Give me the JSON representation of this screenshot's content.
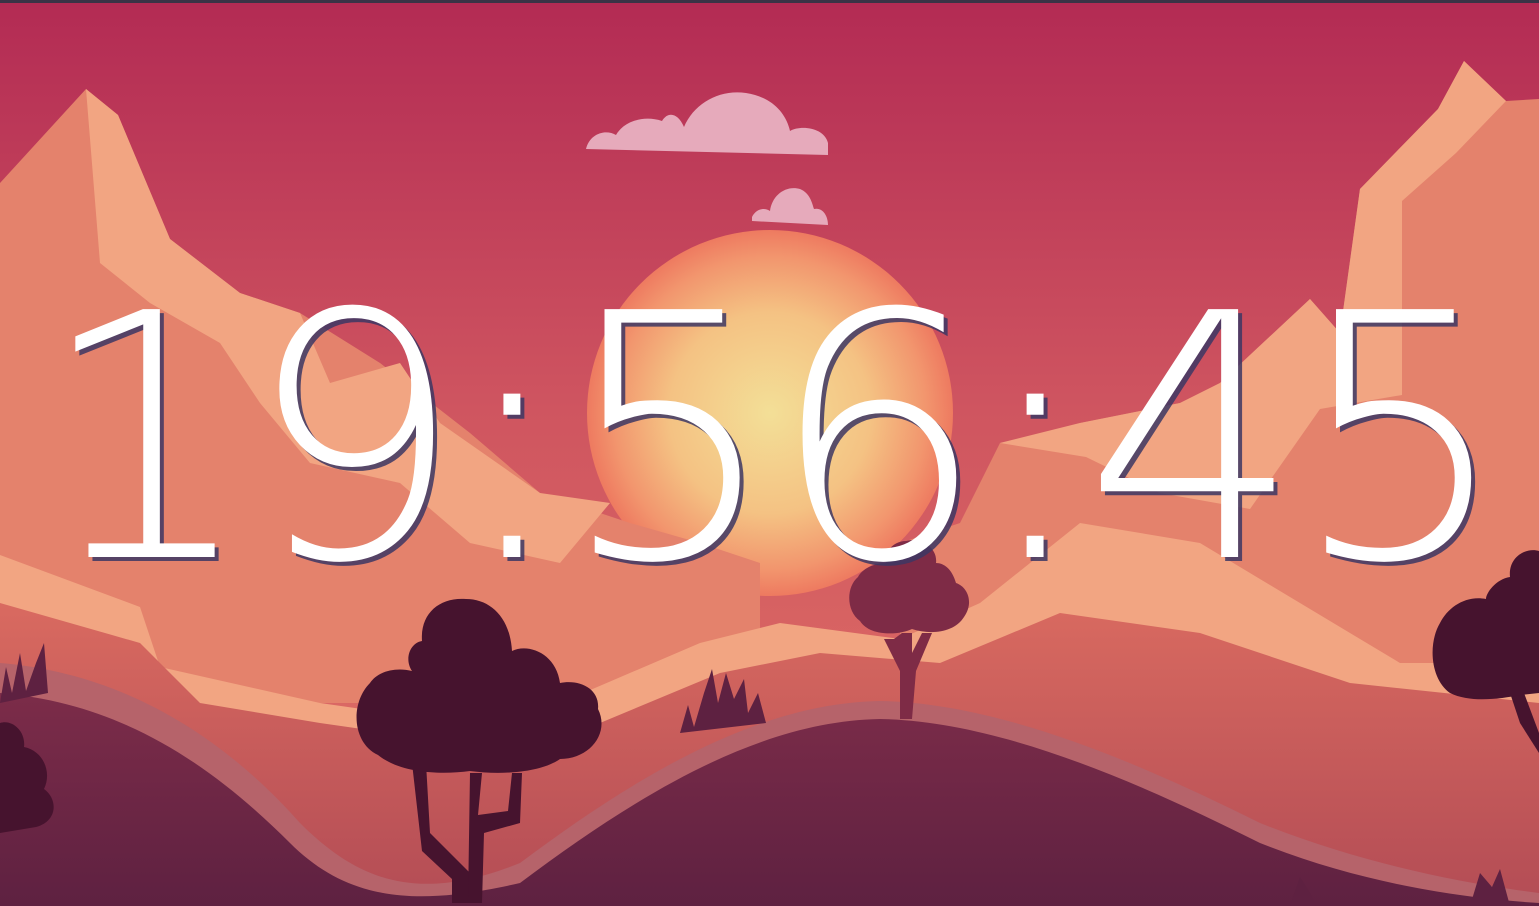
{
  "clock": {
    "time": "19:56:45"
  },
  "colors": {
    "sky_top": "#b32b54",
    "sky_bottom": "#e27466",
    "sun_center": "#f3df97",
    "sun_edge": "#f07c62",
    "mountain_light": "#f2a582",
    "mountain_mid": "#e4826c",
    "hill_dark": "#6e2742",
    "tree_dark": "#46132e",
    "cloud": "#e6aabb",
    "clock_text": "#ffffff",
    "clock_shadow": "#3c3764"
  },
  "icons": {
    "sun": "sun-icon",
    "clouds": "cloud-icon",
    "trees": "tree-icon"
  }
}
